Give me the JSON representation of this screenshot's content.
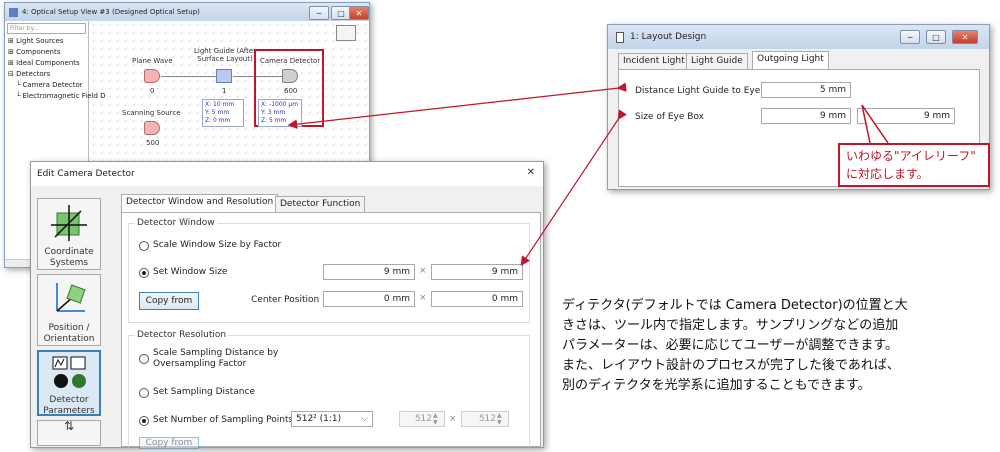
{
  "optical_view": {
    "title": "4: Optical Setup View #3 (Designed Optical Setup)",
    "filter_placeholder": "Filter by...",
    "tree": [
      "Light Sources",
      "Components",
      "Ideal Components",
      "Detectors",
      "Camera Detector",
      "Electromagnetic Field D"
    ],
    "nodes": {
      "plane_wave": {
        "label": "Plane Wave",
        "index": "0"
      },
      "light_guide": {
        "label1": "Light Guide (After",
        "label2": "Surface Layout)",
        "index": "1"
      },
      "camera_detector": {
        "label": "Camera Detector",
        "index": "600"
      },
      "scanning_source": {
        "label": "Scanning Source",
        "index": "500"
      }
    },
    "lg_info": [
      "X: 10 mm",
      "Y: 5 mm",
      "Z: 0 mm"
    ],
    "cd_info": [
      "X: -1000 µm",
      "Y: 3 mm",
      "Z: 5 mm"
    ]
  },
  "layout_design": {
    "title": "1: Layout Design",
    "tabs": [
      "Incident Light",
      "Light Guide",
      "Outgoing Light"
    ],
    "rows": [
      {
        "label": "Distance Light Guide to Eye",
        "values": [
          "5 mm"
        ]
      },
      {
        "label": "Size of Eye Box",
        "values": [
          "9 mm",
          "9 mm"
        ]
      }
    ]
  },
  "callout": {
    "line1": "いわゆる\"アイレリーフ\"",
    "line2": "に対応します。",
    "color": "#c0152a"
  },
  "edit_camera": {
    "title": "Edit Camera Detector",
    "close": "✕",
    "side": [
      {
        "line1": "Coordinate",
        "line2": "Systems"
      },
      {
        "line1": "Position /",
        "line2": "Orientation"
      },
      {
        "line1": "Detector",
        "line2": "Parameters"
      }
    ],
    "tabs": [
      "Detector Window and Resolution",
      "Detector Function"
    ],
    "window_group": "Detector Window",
    "opt_scale": "Scale Window Size by Factor",
    "opt_set": "Set Window Size",
    "window_size": [
      "9 mm",
      "9 mm"
    ],
    "copy_from": "Copy from",
    "center_label": "Center Position",
    "center": [
      "0 mm",
      "0 mm"
    ],
    "times": "×",
    "resolution_group": "Detector Resolution",
    "res_opt1_a": "Scale Sampling Distance by",
    "res_opt1_b": "Oversampling Factor",
    "res_opt2": "Set Sampling Distance",
    "res_opt3": "Set Number of Sampling Points",
    "select_value": "512² (1:1)",
    "points": [
      "512",
      "512"
    ],
    "copy_from2": "Copy from"
  },
  "description": {
    "lines": [
      "ディテクタ(デフォルトでは Camera Detector)の位置と大",
      "きさは、ツール内で指定します。サンプリングなどの追加",
      "パラメーターは、必要に応じてユーザーが調整できます。",
      "また、レイアウト設計のプロセスが完了した後であれば、",
      "別のディテクタを光学系に追加することもできます。"
    ]
  },
  "colors": {
    "highlight": "#c0152a",
    "accent": "#3c7fb1"
  }
}
